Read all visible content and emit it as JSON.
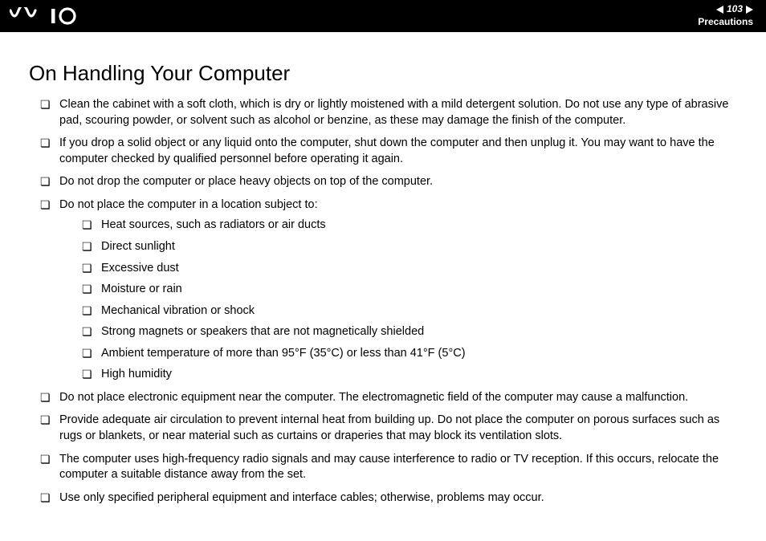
{
  "header": {
    "page_number": "103",
    "section": "Precautions"
  },
  "title": "On Handling Your Computer",
  "items": [
    "Clean the cabinet with a soft cloth, which is dry or lightly moistened with a mild detergent solution. Do not use any type of abrasive pad, scouring powder, or solvent such as alcohol or benzine, as these may damage the finish of the computer.",
    "If you drop a solid object or any liquid onto the computer, shut down the computer and then unplug it. You may want to have the computer checked by qualified personnel before operating it again.",
    "Do not drop the computer or place heavy objects on top of the computer.",
    "Do not place the computer in a location subject to:",
    "Do not place electronic equipment near the computer. The electromagnetic field of the computer may cause a malfunction.",
    "Provide adequate air circulation to prevent internal heat from building up. Do not place the computer on porous surfaces such as rugs or blankets, or near material such as curtains or draperies that may block its ventilation slots.",
    "The computer uses high-frequency radio signals and may cause interference to radio or TV reception. If this occurs, relocate the computer a suitable distance away from the set.",
    "Use only specified peripheral equipment and interface cables; otherwise, problems may occur."
  ],
  "sub_items": [
    "Heat sources, such as radiators or air ducts",
    "Direct sunlight",
    "Excessive dust",
    "Moisture or rain",
    "Mechanical vibration or shock",
    "Strong magnets or speakers that are not magnetically shielded",
    "Ambient temperature of more than 95°F (35°C) or less than 41°F (5°C)",
    "High humidity"
  ]
}
